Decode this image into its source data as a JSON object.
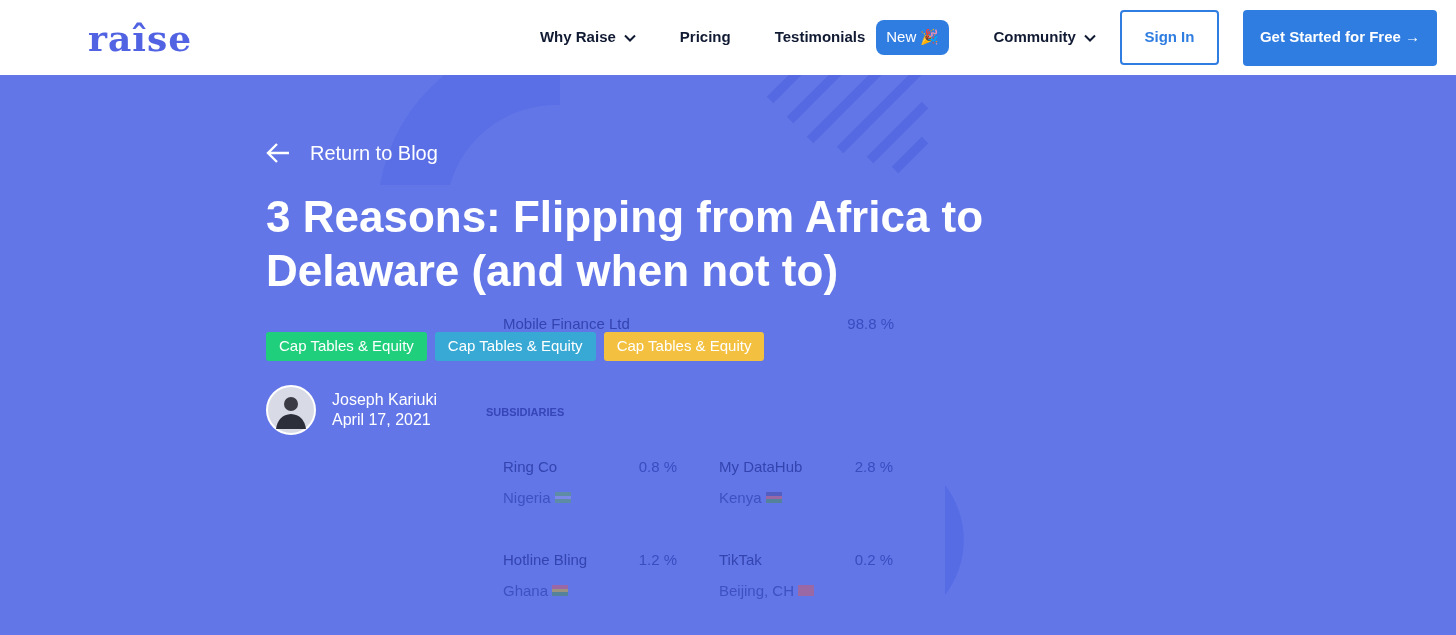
{
  "nav": {
    "logo": "raîse",
    "items": [
      {
        "label": "Why Raise",
        "dropdown": true
      },
      {
        "label": "Pricing",
        "dropdown": false
      },
      {
        "label": "Testimonials",
        "dropdown": false,
        "badge": "New 🎉"
      },
      {
        "label": "Community",
        "dropdown": true
      }
    ],
    "sign_in": "Sign In",
    "cta": "Get Started for Free →"
  },
  "hero": {
    "back_link": "Return to Blog",
    "title": "3 Reasons: Flipping from Africa to Delaware (and when not to)",
    "tags": [
      {
        "label": "Cap Tables & Equity",
        "color": "#1fcf7b"
      },
      {
        "label": "Cap Tables & Equity",
        "color": "#37a9d4"
      },
      {
        "label": "Cap Tables & Equity",
        "color": "#f3c040"
      }
    ],
    "author": {
      "name": "Joseph Kariuki",
      "date": "April 17, 2021"
    },
    "background_card": {
      "parent": {
        "name": "Mobile Finance Ltd",
        "share": "98.8 %"
      },
      "section_label": "SUBSIDIARIES",
      "subsidiaries": [
        {
          "name": "Ring Co",
          "share": "0.8 %",
          "location": "Nigeria"
        },
        {
          "name": "My DataHub",
          "share": "2.8 %",
          "location": "Kenya"
        },
        {
          "name": "Hotline Bling",
          "share": "1.2 %",
          "location": "Ghana"
        },
        {
          "name": "TikTak",
          "share": "0.2 %",
          "location": "Beijing, CH"
        }
      ]
    }
  }
}
